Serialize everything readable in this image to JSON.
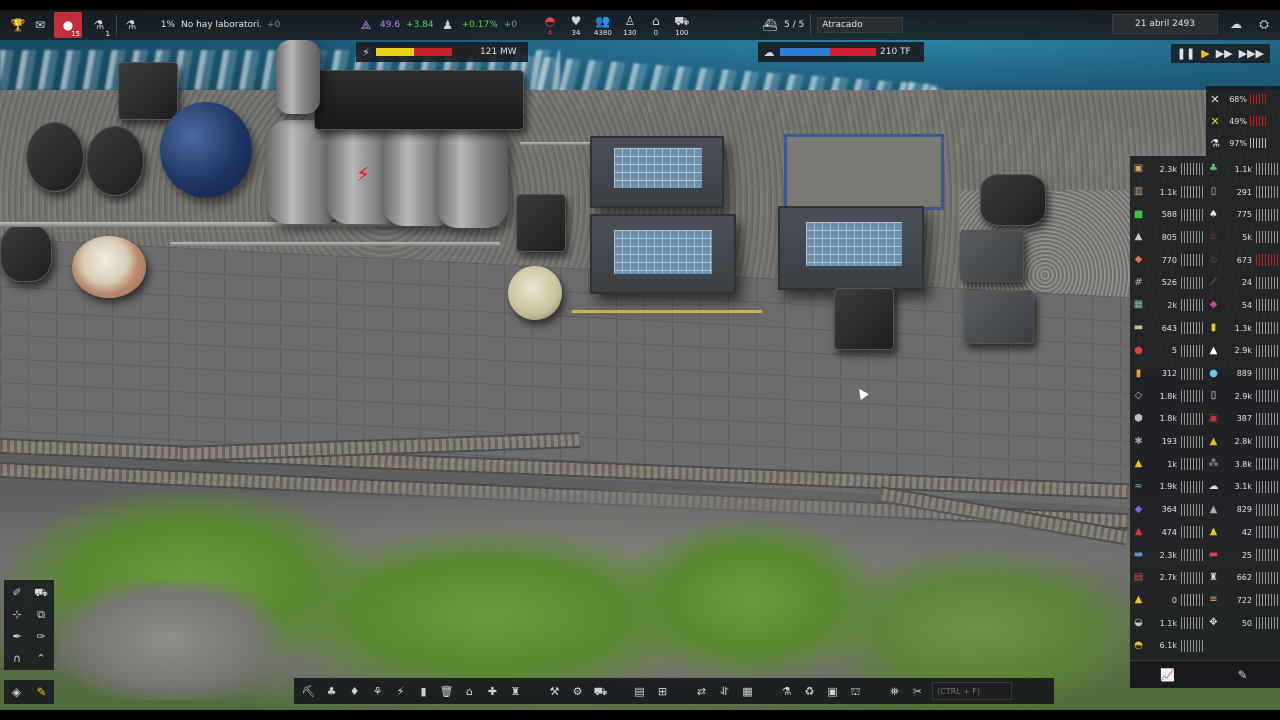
{
  "topbar": {
    "notifications_badge": "15",
    "research_badge": "1",
    "research_percent": "1%",
    "research_status": "No hay laboratori...",
    "research_plus": "+0",
    "unity_value": "49.6",
    "unity_delta": "+3.84",
    "population_delta": "+0.17%",
    "population_plus": "+0",
    "power_value": "121 MW",
    "food_label": "",
    "health_value": "34",
    "workers_value": "4380",
    "unemployed_value": "130",
    "housing_value": "0",
    "vehicles_value": "100",
    "ships_ratio": "5 / 5",
    "ship_status": "Atracado",
    "computing_value": "210 TF",
    "date": "21 abril 2493",
    "food_small": "4"
  },
  "colors": {
    "power_yellow": "#e8d21a",
    "power_red": "#c8202a",
    "computing_blue": "#2d7fd6",
    "computing_red": "#d02030",
    "accent_yellow": "#e8c020",
    "alert_red": "#d01818"
  },
  "bars": {
    "power_fill": 0.38,
    "computing_fill": 0.52
  },
  "stats": [
    {
      "icon": "wrench-icon",
      "value": "68%"
    },
    {
      "icon": "tools-icon",
      "value": "49%"
    },
    {
      "icon": "flask-icon",
      "value": "97%"
    }
  ],
  "resources_left": [
    {
      "icon": "crate-icon",
      "value": "2.3k",
      "gauge": "gray"
    },
    {
      "icon": "barrel-icon",
      "value": "1.1k",
      "gauge": "gray"
    },
    {
      "icon": "plant-icon",
      "value": "588",
      "gauge": "gray"
    },
    {
      "icon": "ore-icon",
      "value": "805",
      "gauge": "gray"
    },
    {
      "icon": "meat-icon",
      "value": "770",
      "gauge": "gray"
    },
    {
      "icon": "rebar-icon",
      "value": "526",
      "gauge": "gray"
    },
    {
      "icon": "panel-icon",
      "value": "2k",
      "gauge": "gray"
    },
    {
      "icon": "sand-icon",
      "value": "643",
      "gauge": "gray"
    },
    {
      "icon": "bulb-icon",
      "value": "5",
      "gauge": "gray"
    },
    {
      "icon": "drum-icon",
      "value": "312",
      "gauge": "gray"
    },
    {
      "icon": "plate-icon",
      "value": "1.8k",
      "gauge": "gray"
    },
    {
      "icon": "stone-icon",
      "value": "1.8k",
      "gauge": "gray"
    },
    {
      "icon": "scrap-icon",
      "value": "193",
      "gauge": "gray"
    },
    {
      "icon": "sulfur-icon",
      "value": "1k",
      "gauge": "gray"
    },
    {
      "icon": "water-icon",
      "value": "1.9k",
      "gauge": "gray"
    },
    {
      "icon": "gem-icon",
      "value": "364",
      "gauge": "gray"
    },
    {
      "icon": "chili-icon",
      "value": "474",
      "gauge": "gray"
    },
    {
      "icon": "steel-icon",
      "value": "2.3k",
      "gauge": "gray"
    },
    {
      "icon": "brick-icon",
      "value": "2.7k",
      "gauge": "gray"
    },
    {
      "icon": "pile-icon",
      "value": "0",
      "gauge": "gray"
    },
    {
      "icon": "dust-icon",
      "value": "1.1k",
      "gauge": "gray"
    },
    {
      "icon": "bread-icon",
      "value": "6.1k",
      "gauge": "gray"
    }
  ],
  "resources_right": [
    {
      "icon": "leaf-icon",
      "value": "1.1k",
      "gauge": "gray"
    },
    {
      "icon": "tube-icon",
      "value": "291",
      "gauge": "gray"
    },
    {
      "icon": "mushroom-icon",
      "value": "775",
      "gauge": "gray"
    },
    {
      "icon": "fire-icon",
      "value": "5k",
      "gauge": "gray"
    },
    {
      "icon": "flame-icon",
      "value": "673",
      "gauge": "red"
    },
    {
      "icon": "tube2-icon",
      "value": "24",
      "gauge": "gray"
    },
    {
      "icon": "ingot-icon",
      "value": "54",
      "gauge": "gray"
    },
    {
      "icon": "bottle-icon",
      "value": "1.3k",
      "gauge": "gray"
    },
    {
      "icon": "salt-icon",
      "value": "2.9k",
      "gauge": "gray"
    },
    {
      "icon": "drop-icon",
      "value": "889",
      "gauge": "gray"
    },
    {
      "icon": "canister-icon",
      "value": "2.9k",
      "gauge": "gray"
    },
    {
      "icon": "chip-icon",
      "value": "387",
      "gauge": "gray"
    },
    {
      "icon": "pyramid-icon",
      "value": "2.8k",
      "gauge": "gray"
    },
    {
      "icon": "gravel-icon",
      "value": "3.8k",
      "gauge": "gray"
    },
    {
      "icon": "cloud-icon",
      "value": "3.1k",
      "gauge": "gray"
    },
    {
      "icon": "mound-icon",
      "value": "829",
      "gauge": "gray"
    },
    {
      "icon": "gold-icon",
      "value": "42",
      "gauge": "gray"
    },
    {
      "icon": "capsule-icon",
      "value": "25",
      "gauge": "gray"
    },
    {
      "icon": "robot-icon",
      "value": "662",
      "gauge": "gray"
    },
    {
      "icon": "bars-icon",
      "value": "722",
      "gauge": "gray"
    },
    {
      "icon": "drone-icon",
      "value": "50",
      "gauge": "gray"
    }
  ],
  "search": {
    "placeholder": "(CTRL + F)"
  }
}
